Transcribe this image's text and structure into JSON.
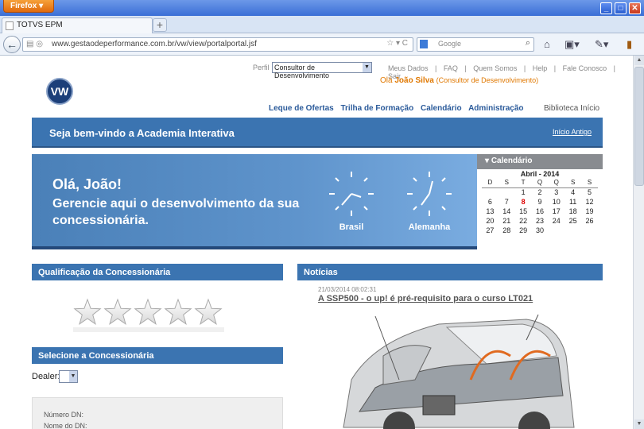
{
  "browser": {
    "menu_label": "Firefox",
    "tab_title": "TOTVS EPM",
    "new_tab": "+",
    "url": "www.gestaodeperformance.com.br/vw/view/portalportal.jsf",
    "search_placeholder": "Google"
  },
  "header": {
    "perfil_label": "Perfil",
    "perfil_value": "Consultor de Desenvolvimento",
    "top_links": [
      "Meus Dados",
      "|",
      "FAQ",
      "|",
      "Quem Somos",
      "|",
      "Help",
      "|",
      "Fale Conosco",
      "|",
      "Sair"
    ],
    "greeting": "Olá",
    "user_name": "João Silva",
    "user_role": "(Consultor de Desenvolvimento)",
    "main_nav": [
      "Leque de Ofertas",
      "Trilha de Formação",
      "Calendário",
      "Administração"
    ],
    "right_nav": [
      "Biblioteca",
      "Início"
    ],
    "logo_text": "VW"
  },
  "welcome": {
    "title": "Seja bem-vindo a Academia Interativa",
    "link": "Início Antigo"
  },
  "banner": {
    "headline": "Olá, João!",
    "subline": "Gerencie aqui o desenvolvimento da sua concessionária.",
    "clock1": "Brasil",
    "clock2": "Alemanha"
  },
  "calendar": {
    "title": "Calendário",
    "month": "Abril - 2014",
    "weekdays": [
      "D",
      "S",
      "T",
      "Q",
      "Q",
      "S",
      "S"
    ],
    "weeks": [
      [
        "",
        "",
        "1",
        "2",
        "3",
        "4",
        "5"
      ],
      [
        "6",
        "7",
        "8",
        "9",
        "10",
        "11",
        "12"
      ],
      [
        "13",
        "14",
        "15",
        "16",
        "17",
        "18",
        "19"
      ],
      [
        "20",
        "21",
        "22",
        "23",
        "24",
        "25",
        "26"
      ],
      [
        "27",
        "28",
        "29",
        "30",
        "",
        "",
        ""
      ]
    ],
    "today": "8"
  },
  "left": {
    "qualificacao_title": "Qualificação da Concessionária",
    "selecione_title": "Selecione a Concessionária",
    "dealer_label": "Dealer:",
    "dn_number": "Número DN:",
    "dn_name": "Nome do DN:"
  },
  "news": {
    "title": "Notícias",
    "date": "21/03/2014 08:02:31",
    "headline": "A SSP500 - o up! é pré-requisito para o curso LT021"
  },
  "colors": {
    "accent": "#3b74b1",
    "user_highlight": "#e07800",
    "calendar_header": "#888b90"
  }
}
